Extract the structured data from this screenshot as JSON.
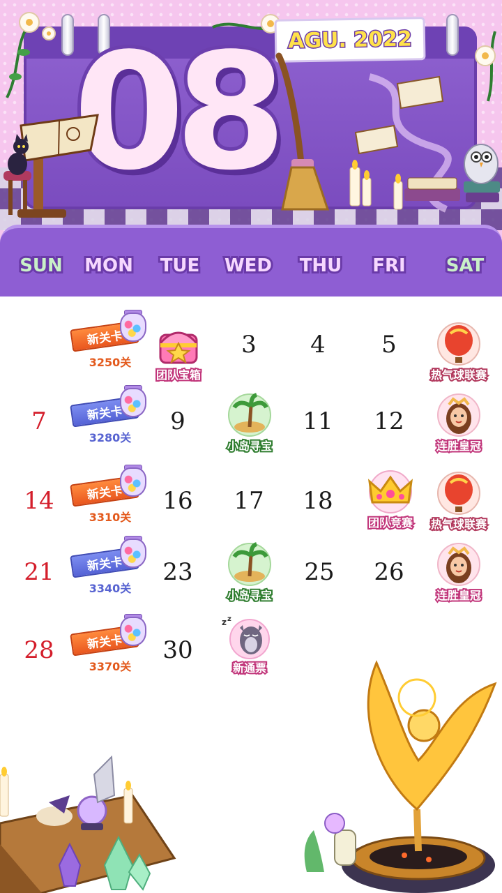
{
  "header": {
    "month_number": "08",
    "month_label": "AGU. 2022"
  },
  "weekdays": [
    {
      "label": "SUN",
      "weekend": true
    },
    {
      "label": "MON",
      "weekend": false
    },
    {
      "label": "TUE",
      "weekend": false
    },
    {
      "label": "WED",
      "weekend": false
    },
    {
      "label": "THU",
      "weekend": false
    },
    {
      "label": "FRI",
      "weekend": false
    },
    {
      "label": "SAT",
      "weekend": true
    }
  ],
  "days": {
    "d3": "3",
    "d4": "4",
    "d5": "5",
    "d7": "7",
    "d9": "9",
    "d11": "11",
    "d12": "12",
    "d14": "14",
    "d16": "16",
    "d17": "17",
    "d18": "18",
    "d21": "21",
    "d23": "23",
    "d25": "25",
    "d26": "26",
    "d28": "28",
    "d30": "30"
  },
  "level_cards": [
    {
      "ribbon": "新关卡",
      "level": "3250关",
      "color": "orange"
    },
    {
      "ribbon": "新关卡",
      "level": "3280关",
      "color": "blue"
    },
    {
      "ribbon": "新关卡",
      "level": "3310关",
      "color": "orange"
    },
    {
      "ribbon": "新关卡",
      "level": "3340关",
      "color": "blue"
    },
    {
      "ribbon": "新关卡",
      "level": "3370关",
      "color": "orange"
    }
  ],
  "events": {
    "team_chest": "团队宝箱",
    "balloon_league_1": "热气球联赛",
    "island_treasure_1": "小岛寻宝",
    "win_streak_crown_1": "连胜皇冠",
    "team_contest": "团队竞赛",
    "balloon_league_2": "热气球联赛",
    "island_treasure_2": "小岛寻宝",
    "win_streak_crown_2": "连胜皇冠",
    "new_pass": "新通票"
  },
  "colors": {
    "board_purple": "#7b4cbf",
    "bar_purple": "#8e5ed3",
    "weekend_red": "#d41e2b",
    "pink_background": "#f6c6ee",
    "banner_yellow": "#ffe24a"
  }
}
